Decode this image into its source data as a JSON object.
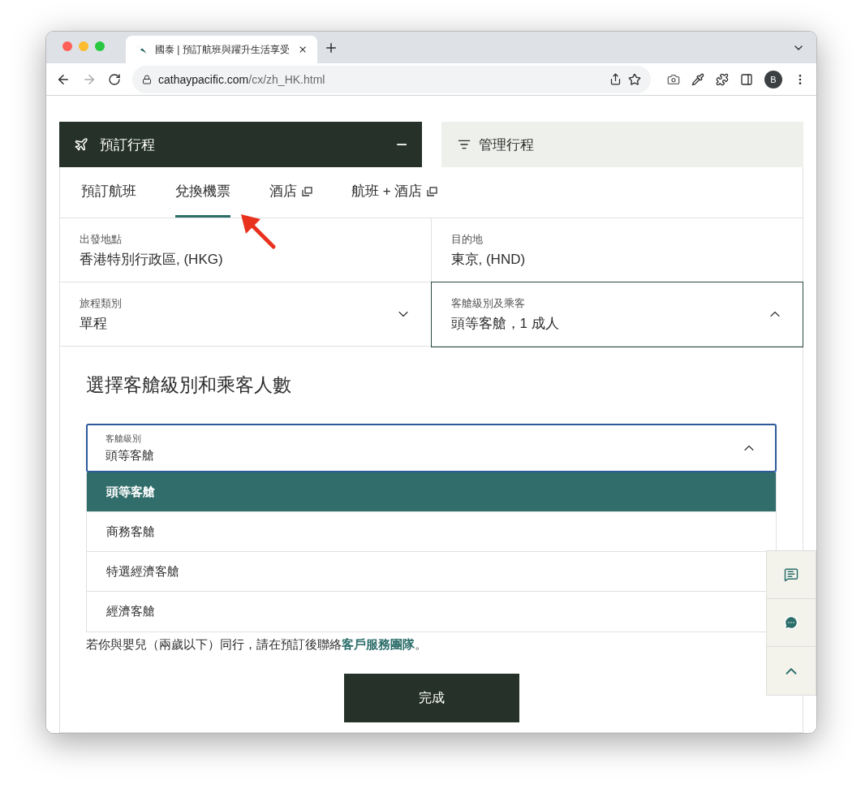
{
  "browser": {
    "tab_title": "國泰 | 預訂航班與躍升生活享受",
    "url_host": "cathaypacific.com",
    "url_path": "/cx/zh_HK.html",
    "profile": "B"
  },
  "booking": {
    "header_title": "預訂行程",
    "collapse_symbol": "−",
    "manage_title": "管理行程",
    "tabs": [
      {
        "label": "預訂航班",
        "selected": false,
        "external": false
      },
      {
        "label": "兌換機票",
        "selected": true,
        "external": false
      },
      {
        "label": "酒店",
        "selected": false,
        "external": true
      },
      {
        "label": "航班 + 酒店",
        "selected": false,
        "external": true
      }
    ],
    "fields": [
      {
        "kind": "text",
        "label": "出發地點",
        "value": "香港特別行政區, (HKG)"
      },
      {
        "kind": "text",
        "label": "目的地",
        "value": "東京, (HND)"
      },
      {
        "kind": "select",
        "label": "旅程類別",
        "value": "單程",
        "expanded": false
      },
      {
        "kind": "select",
        "label": "客艙級別及乘客",
        "value": "頭等客艙，1 成人",
        "expanded": true
      }
    ],
    "cabin_panel": {
      "heading": "選擇客艙級別和乘客人數",
      "select": {
        "label": "客艙級別",
        "value": "頭等客艙",
        "expanded": true
      },
      "options": [
        {
          "label": "頭等客艙",
          "selected": true
        },
        {
          "label": "商務客艙",
          "selected": false
        },
        {
          "label": "特選經濟客艙",
          "selected": false
        },
        {
          "label": "經濟客艙",
          "selected": false
        }
      ],
      "note_text": "若你與嬰兒（兩歲以下）同行，請在預訂後聯絡",
      "note_link": "客戶服務團隊",
      "note_end": "。",
      "done_button": "完成"
    }
  }
}
